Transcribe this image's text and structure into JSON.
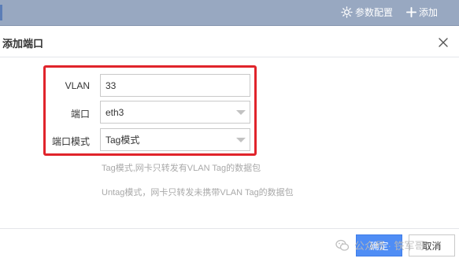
{
  "topbar": {
    "config_label": "参数配置",
    "add_label": "添加"
  },
  "dialog": {
    "title": "添加端口"
  },
  "form": {
    "vlan": {
      "label": "VLAN",
      "value": "33"
    },
    "port": {
      "label": "端口",
      "value": "eth3"
    },
    "port_mode": {
      "label": "端口模式",
      "value": "Tag模式"
    }
  },
  "hints": {
    "tag": "Tag模式,网卡只转发有VLAN Tag的数据包",
    "untag": "Untag模式，网卡只转发未携带VLAN Tag的数据包"
  },
  "footer": {
    "confirm_label": "确定",
    "cancel_label": "取消"
  },
  "watermark": {
    "text": "公众号 · 铁军哥"
  },
  "colors": {
    "primary": "#4f8df5",
    "highlight": "#e0242b",
    "topbar": "#98a8c1"
  }
}
